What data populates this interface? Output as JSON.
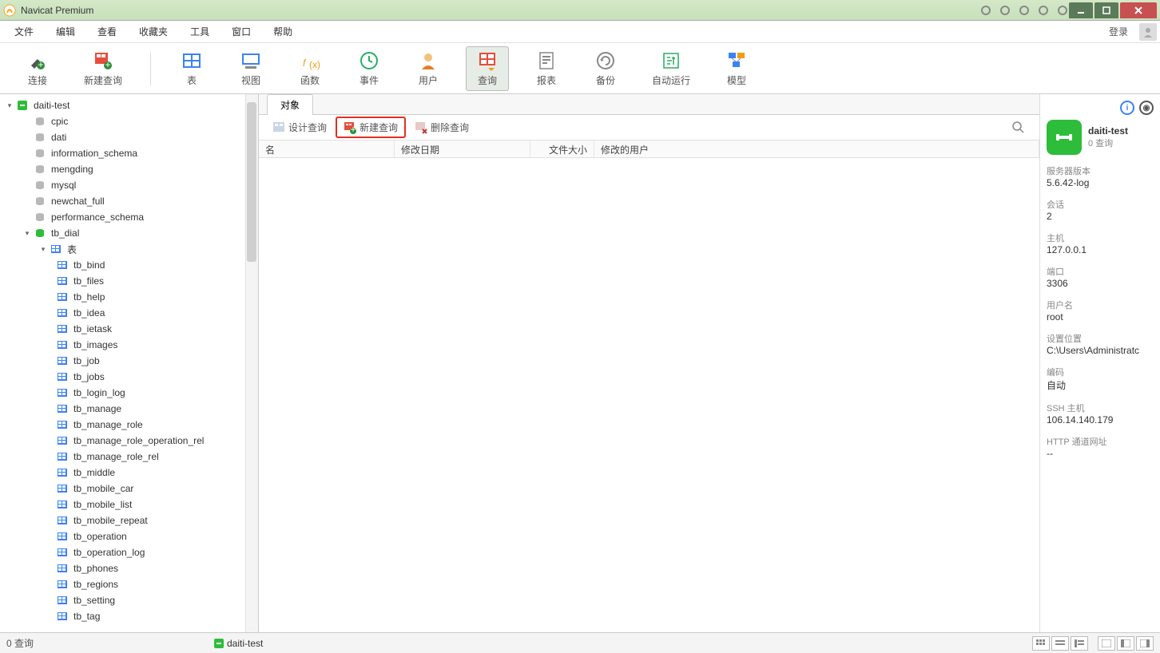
{
  "window": {
    "title": "Navicat Premium"
  },
  "menu": {
    "items": [
      "文件",
      "编辑",
      "查看",
      "收藏夹",
      "工具",
      "窗口",
      "帮助"
    ],
    "login": "登录"
  },
  "toolbar": {
    "connect": "连接",
    "new_query": "新建查询",
    "table": "表",
    "view": "视图",
    "function": "函数",
    "event": "事件",
    "user": "用户",
    "query": "查询",
    "report": "报表",
    "backup": "备份",
    "auto_run": "自动运行",
    "model": "模型"
  },
  "tree": {
    "connection": "daiti-test",
    "databases": [
      "cpic",
      "dati",
      "information_schema",
      "mengding",
      "mysql",
      "newchat_full",
      "performance_schema"
    ],
    "open_db": "tb_dial",
    "tables_node": "表",
    "tables": [
      "tb_bind",
      "tb_files",
      "tb_help",
      "tb_idea",
      "tb_ietask",
      "tb_images",
      "tb_job",
      "tb_jobs",
      "tb_login_log",
      "tb_manage",
      "tb_manage_role",
      "tb_manage_role_operation_rel",
      "tb_manage_role_rel",
      "tb_middle",
      "tb_mobile_car",
      "tb_mobile_list",
      "tb_mobile_repeat",
      "tb_operation",
      "tb_operation_log",
      "tb_phones",
      "tb_regions",
      "tb_setting",
      "tb_tag"
    ]
  },
  "content": {
    "tab": "对象",
    "qbar": {
      "design": "设计查询",
      "new": "新建查询",
      "delete": "删除查询"
    },
    "columns": {
      "name": "名",
      "date": "修改日期",
      "size": "文件大小",
      "user": "修改的用户"
    }
  },
  "right": {
    "conn_name": "daiti-test",
    "conn_sub": "0 查询",
    "server_version_l": "服务器版本",
    "server_version_v": "5.6.42-log",
    "session_l": "会话",
    "session_v": "2",
    "host_l": "主机",
    "host_v": "127.0.0.1",
    "port_l": "端口",
    "port_v": "3306",
    "user_l": "用户名",
    "user_v": "root",
    "setting_loc_l": "设置位置",
    "setting_loc_v": "C:\\Users\\Administratc",
    "encoding_l": "编码",
    "encoding_v": "自动",
    "ssh_l": "SSH 主机",
    "ssh_v": "106.14.140.179",
    "http_l": "HTTP 通道网址",
    "http_v": "--"
  },
  "status": {
    "left": "0 查询",
    "conn": "daiti-test"
  }
}
